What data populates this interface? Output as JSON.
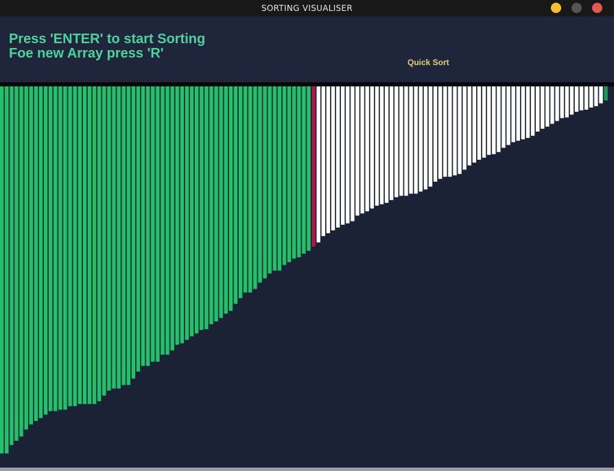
{
  "window": {
    "title": "SORTING VISUALISER"
  },
  "controls": {
    "minimize_color": "#f5c02c",
    "maximize_color": "#555555",
    "close_color": "#e5574f"
  },
  "header": {
    "line1": "Press 'ENTER' to start Sorting",
    "line2": "Foe new Array press 'R'",
    "algorithm": "Quick Sort",
    "text_color": "#4cd39a",
    "algorithm_color": "#e0d170",
    "background": "#1f253a"
  },
  "colors": {
    "sorted": "#1ec46a",
    "pivot": "#b0174a",
    "unsorted": "#ffffff",
    "last": "#179a5a",
    "background": "#1c2235"
  },
  "bars": {
    "note": "array values (height of each bar relative to max)",
    "values": [
      520,
      520,
      508,
      502,
      496,
      486,
      479,
      474,
      470,
      465,
      460,
      460,
      458,
      458,
      453,
      453,
      450,
      450,
      450,
      450,
      446,
      438,
      431,
      428,
      428,
      423,
      423,
      414,
      404,
      396,
      396,
      390,
      390,
      380,
      380,
      374,
      366,
      364,
      359,
      354,
      350,
      345,
      344,
      337,
      333,
      328,
      322,
      318,
      308,
      300,
      292,
      292,
      287,
      278,
      272,
      265,
      261,
      261,
      253,
      249,
      244,
      242,
      237,
      233,
      227,
      221,
      212,
      208,
      204,
      200,
      196,
      194,
      191,
      183,
      180,
      177,
      173,
      169,
      167,
      165,
      161,
      157,
      155,
      155,
      152,
      152,
      149,
      146,
      142,
      135,
      131,
      128,
      128,
      126,
      124,
      118,
      112,
      108,
      104,
      101,
      97,
      96,
      93,
      87,
      83,
      79,
      77,
      75,
      73,
      70,
      64,
      60,
      57,
      53,
      49,
      45,
      44,
      40,
      36,
      34,
      33,
      30,
      28,
      24,
      20
    ],
    "sorted_count": 64,
    "pivot_index": 64,
    "unsorted_end": 123,
    "last_index": 124
  }
}
